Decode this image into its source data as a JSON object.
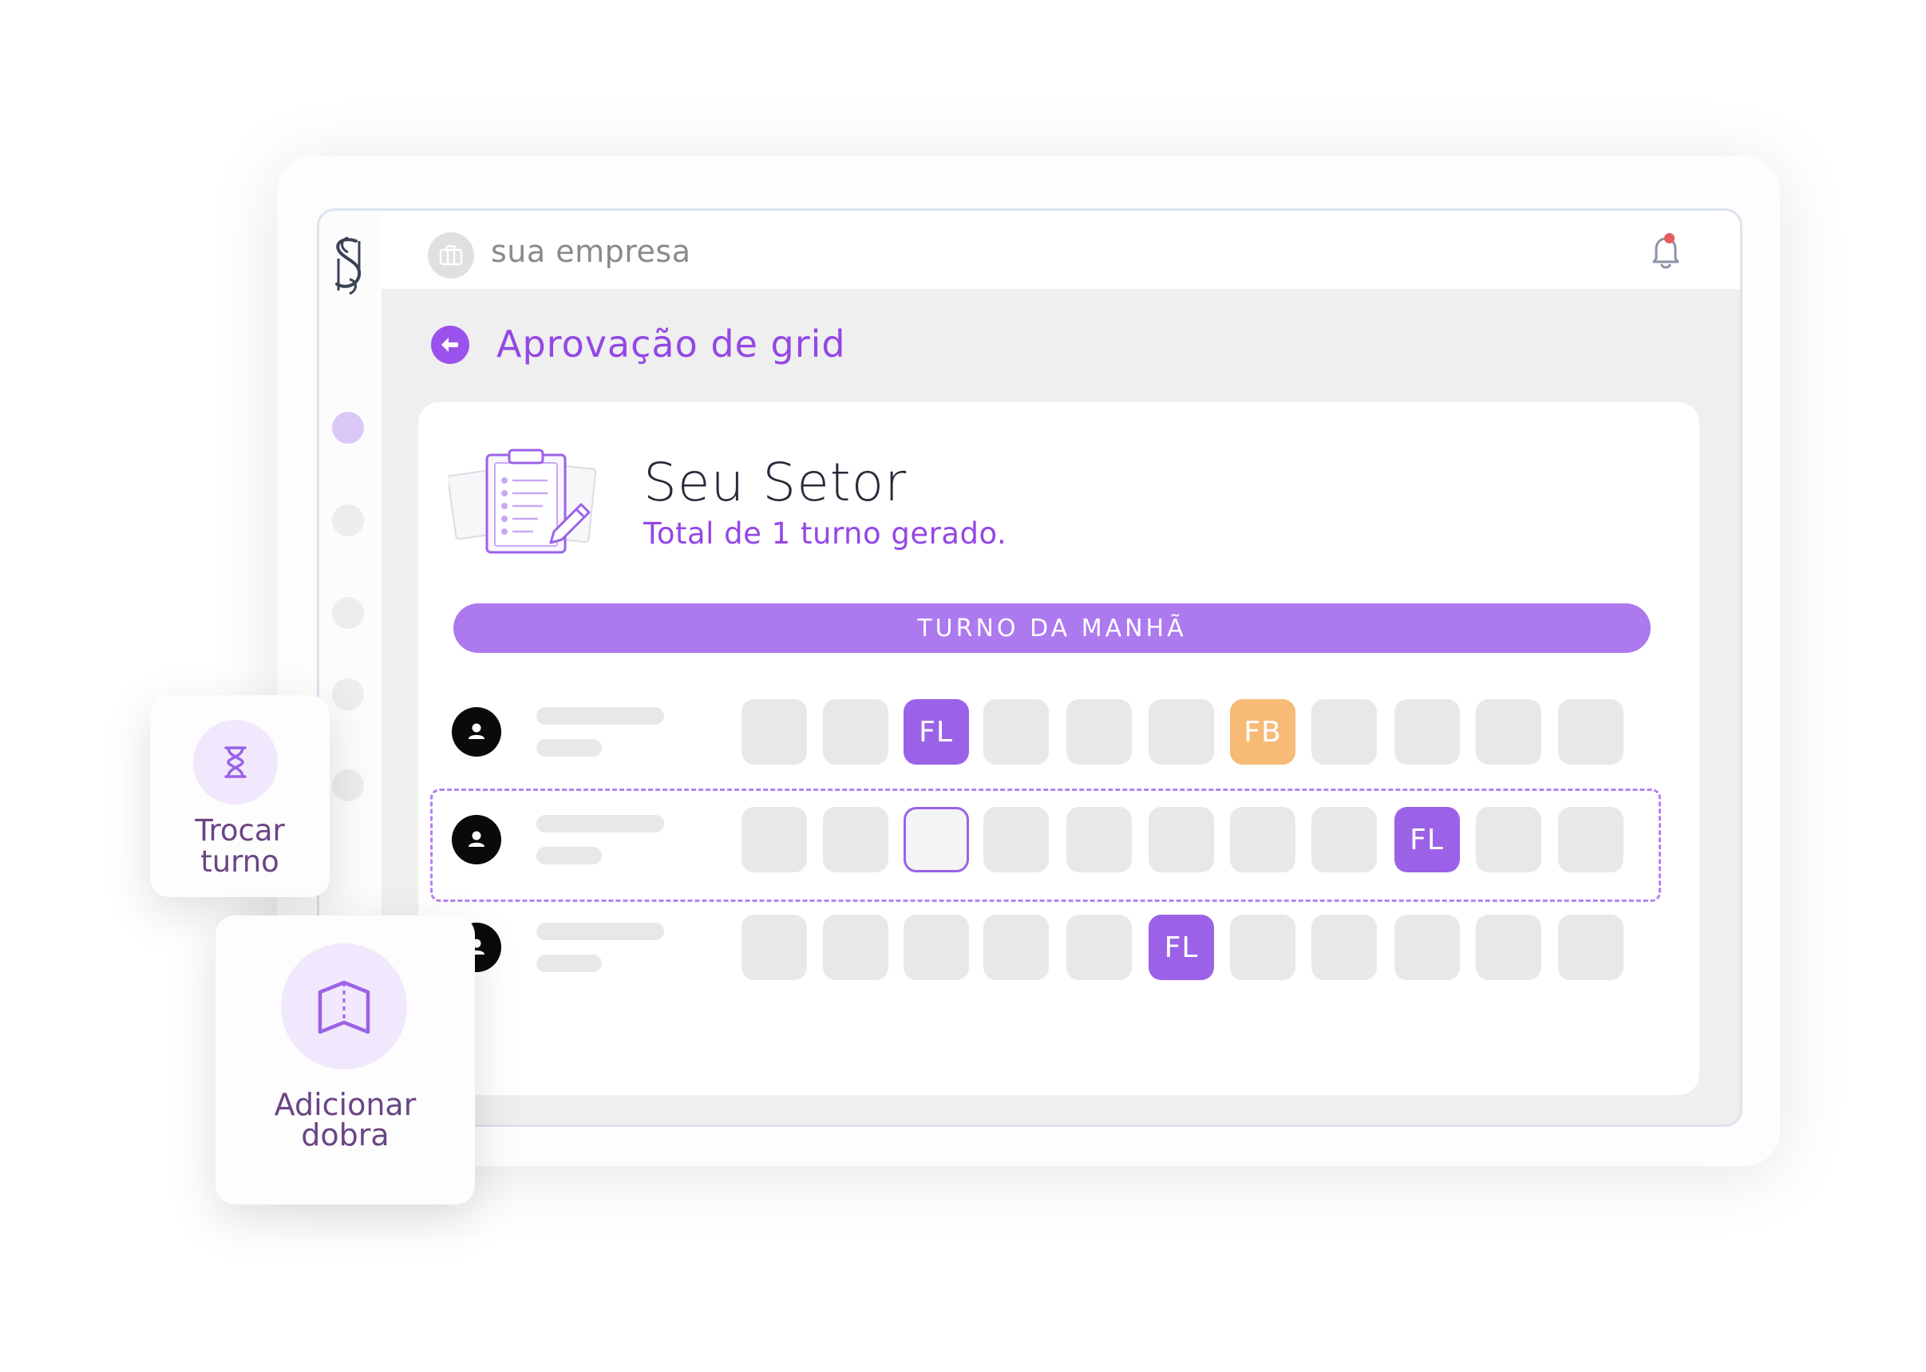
{
  "topbar": {
    "company_name": "sua empresa",
    "company_icon": "briefcase-icon",
    "notification_icon": "bell-icon",
    "has_unread_notifications": true
  },
  "sidebar": {
    "logo": "app-logo",
    "nav_items": [
      {
        "active": true
      },
      {
        "active": false
      },
      {
        "active": false
      },
      {
        "active": false
      },
      {
        "active": false
      }
    ]
  },
  "header": {
    "back_icon": "arrow-left-icon",
    "title": "Aprovação de grid"
  },
  "sector": {
    "illustration": "clipboard-illustration",
    "title": "Seu Setor",
    "subtitle": "Total de 1 turno gerado."
  },
  "shift": {
    "label": "TURNO DA MANHÃ"
  },
  "grid": {
    "rows": [
      {
        "cells": [
          "",
          "",
          "FL",
          "",
          "",
          "",
          "FB",
          "",
          "",
          "",
          ""
        ]
      },
      {
        "selected": true,
        "cells": [
          "",
          "",
          "",
          "",
          "",
          "",
          "",
          "",
          "FL",
          "",
          ""
        ],
        "selected_cell": 2
      },
      {
        "cells": [
          "",
          "",
          "",
          "",
          "",
          "FL",
          "",
          "",
          "",
          "",
          ""
        ]
      }
    ]
  },
  "actions": {
    "swap_shift": {
      "icon": "hourglass-icon",
      "label_line1": "Trocar",
      "label_line2": "turno"
    },
    "add_fold": {
      "icon": "map-icon",
      "label_line1": "Adicionar",
      "label_line2": "dobra"
    }
  },
  "colors": {
    "accent": "#9b62e8",
    "shift_bar": "#ad79ef",
    "fb": "#f7bb76",
    "empty_cell": "#e8e8e8",
    "notification_dot": "#e35d5d"
  }
}
